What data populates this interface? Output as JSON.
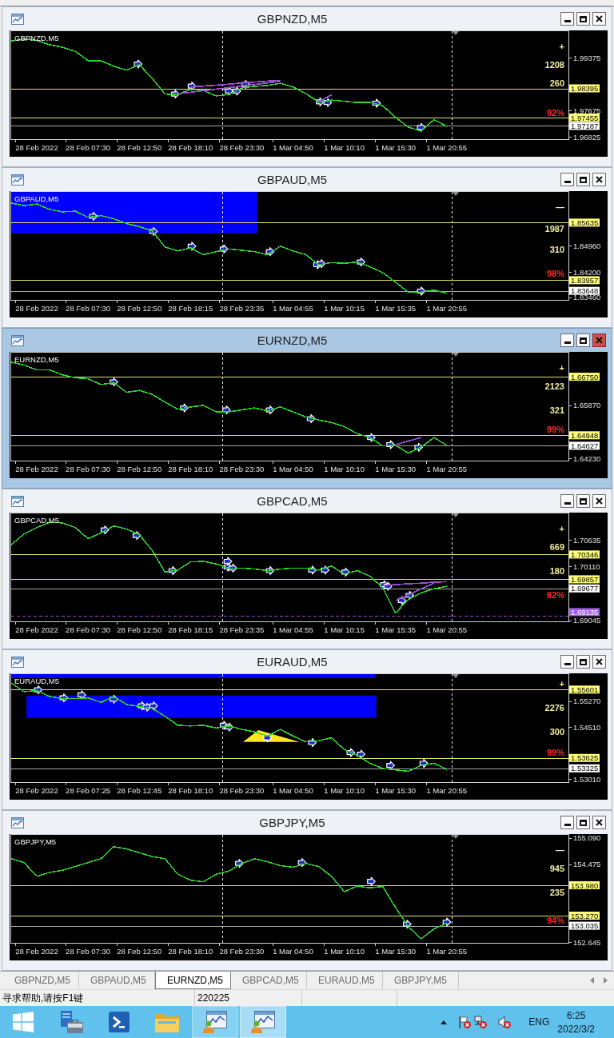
{
  "windows": [
    {
      "title": "GBPNZD,M5",
      "active": false,
      "chart_data": {
        "type": "line",
        "ylim": [
          1.9676,
          2.00238
        ],
        "categories": [
          null,
          null,
          "28 Feb 2022",
          null,
          null,
          null,
          "28 Feb 07:30",
          null,
          null,
          null,
          "28 Feb 12:50",
          null,
          null,
          null,
          "28 Feb 18:10",
          null,
          null,
          null,
          "28 Feb 23:30",
          null,
          null,
          null,
          "1 Mar 04:50",
          null,
          null,
          null,
          "1 Mar 10:10",
          null,
          null,
          null,
          "1 Mar 15:30",
          null,
          null,
          null,
          "1 Mar 20:55",
          null,
          null,
          null,
          null,
          null,
          null,
          null,
          null,
          null
        ],
        "yticks": [
          {
            "value": 1.99375,
            "label": "1.99375"
          },
          {
            "value": 1.97675,
            "label": "1.97675"
          },
          {
            "value": 1.96825,
            "label": "1.96825"
          }
        ],
        "series": [
          {
            "name": "GBPNZD,M5",
            "color": "#2fd52f",
            "values": [
              1.9992,
              1.9998,
              1.9994,
              1.998,
              1.9972,
              1.9959,
              1.9929,
              1.9929,
              1.9911,
              1.9898,
              1.9916,
              1.9872,
              1.9821,
              1.982,
              1.9836,
              1.9833,
              1.9815,
              1.982,
              1.9841,
              1.9846,
              1.9849,
              1.9856,
              1.9844,
              1.9823,
              1.9795,
              1.9802,
              1.9798,
              1.9794,
              1.9795,
              1.9784,
              1.9746,
              1.9715,
              1.9702,
              1.9739,
              1.9717,
              null,
              null,
              null,
              null,
              null,
              null,
              null,
              null,
              null
            ]
          },
          {
            "color": "#9b4fd0",
            "values": [
              null,
              null,
              null,
              null,
              null,
              null,
              null,
              null,
              null,
              null,
              null,
              null,
              null,
              1.9822,
              1.9827,
              1.9832,
              1.9837,
              1.9842,
              1.9847,
              1.9852,
              1.9857,
              1.9862,
              null,
              null,
              null,
              null,
              null,
              null,
              null,
              null,
              null,
              null,
              null,
              null,
              null,
              null,
              null,
              null,
              null,
              null,
              null,
              null,
              null,
              null
            ]
          },
          {
            "color": "#9b4fd0",
            "values": [
              null,
              null,
              null,
              null,
              null,
              null,
              null,
              null,
              null,
              null,
              null,
              null,
              null,
              null,
              1.9844,
              1.9847,
              1.985,
              1.9853,
              1.9857,
              1.986,
              1.9863,
              1.9866,
              null,
              null,
              null,
              null,
              null,
              null,
              null,
              null,
              null,
              null,
              null,
              null,
              null,
              null,
              null,
              null,
              null,
              null,
              null,
              null,
              null,
              null
            ]
          },
          {
            "color": "#9b4fd0",
            "values": [
              null,
              null,
              null,
              null,
              null,
              null,
              null,
              null,
              null,
              null,
              null,
              null,
              null,
              null,
              null,
              null,
              null,
              null,
              null,
              null,
              null,
              null,
              null,
              null,
              1.9796,
              1.9819,
              null,
              null,
              null,
              null,
              null,
              null,
              null,
              null,
              null,
              null,
              null,
              null,
              null,
              null,
              null,
              null,
              null,
              null
            ]
          }
        ],
        "ref_lines": [
          {
            "axis": "y",
            "value": 1.98395,
            "label": "1.98395",
            "color": "#e2e26a"
          },
          {
            "axis": "y",
            "value": 1.97455,
            "label": "1.97455",
            "color": "#e2e26a"
          },
          {
            "axis": "y",
            "value": 1.97187,
            "label": "1.97187",
            "color": "#a6a6a6"
          }
        ]
      },
      "indicator_labels": [
        {
          "text": "+",
          "color": "#f0eca0"
        },
        {
          "text": "1208",
          "color": "#f0eca0"
        },
        {
          "text": "260",
          "color": "#f0eca0"
        },
        {
          "text": "92%",
          "color": "#ff2828"
        }
      ]
    },
    {
      "title": "GBPAUD,M5",
      "active": false,
      "chart_data": {
        "type": "line",
        "ylim": [
          1.83384,
          1.86531
        ],
        "categories": [
          null,
          null,
          "28 Feb 2022",
          null,
          null,
          null,
          "28 Feb 07:30",
          null,
          null,
          null,
          "28 Feb 12:50",
          null,
          null,
          null,
          "28 Feb 18:15",
          null,
          null,
          null,
          "28 Feb 23:35",
          null,
          null,
          null,
          "1 Mar 04:55",
          null,
          null,
          null,
          "1 Mar 10:15",
          null,
          null,
          null,
          "1 Mar 15:35",
          null,
          null,
          null,
          "1 Mar 20:55",
          null,
          null,
          null,
          null,
          null,
          null,
          null,
          null,
          null
        ],
        "yticks": [
          {
            "value": 1.8496,
            "label": "1.84960"
          },
          {
            "value": 1.842,
            "label": "1.84200"
          },
          {
            "value": 1.8346,
            "label": "1.83460"
          }
        ],
        "series": [
          {
            "name": "GBPAUD,M5",
            "color": "#2fd52f",
            "values": [
              1.8621,
              1.8613,
              1.8618,
              1.8602,
              1.8595,
              1.8597,
              1.8579,
              1.8584,
              1.8575,
              1.8561,
              1.8552,
              1.8539,
              1.8493,
              1.8481,
              1.849,
              1.847,
              1.8479,
              1.8487,
              1.8483,
              1.8479,
              1.847,
              1.8495,
              1.8481,
              1.847,
              1.8441,
              1.8447,
              1.8445,
              1.8449,
              1.8435,
              1.8418,
              1.839,
              1.8361,
              1.8361,
              1.8367,
              1.8358,
              null,
              null,
              null,
              null,
              null,
              null,
              null,
              null,
              null
            ]
          }
        ],
        "ref_lines": [
          {
            "axis": "y",
            "value": 1.85635,
            "label": "1.85635",
            "color": "#e2e26a"
          },
          {
            "axis": "y",
            "value": 1.83957,
            "label": "1.83957",
            "color": "#e2e26a"
          },
          {
            "axis": "y",
            "value": 1.83648,
            "label": "1.83648",
            "color": "#a6a6a6"
          }
        ]
      },
      "indicator_labels": [
        {
          "text": "—",
          "color": "#f0f0f0"
        },
        {
          "text": "1987",
          "color": "#f0eca0"
        },
        {
          "text": "310",
          "color": "#f0eca0"
        },
        {
          "text": "98%",
          "color": "#ff2828"
        }
      ]
    },
    {
      "title": "EURNZD,M5",
      "active": true,
      "chart_data": {
        "type": "line",
        "ylim": [
          1.64168,
          1.67492
        ],
        "categories": [
          null,
          null,
          "28 Feb 2022",
          null,
          null,
          null,
          "28 Feb 07:30",
          null,
          null,
          null,
          "28 Feb 12:50",
          null,
          null,
          null,
          "28 Feb 18:10",
          null,
          null,
          null,
          "28 Feb 23:30",
          null,
          null,
          null,
          "1 Mar 04:50",
          null,
          null,
          null,
          "1 Mar 10:10",
          null,
          null,
          null,
          "1 Mar 15:30",
          null,
          null,
          null,
          "1 Mar 20:55",
          null,
          null,
          null,
          null,
          null,
          null,
          null,
          null,
          null
        ],
        "yticks": [
          {
            "value": 1.6587,
            "label": "1.65870"
          },
          {
            "value": 1.6423,
            "label": "1.64230"
          }
        ],
        "series": [
          {
            "name": "EURNZD,M5",
            "color": "#2fd52f",
            "values": [
              1.672,
              1.6711,
              1.6696,
              1.6696,
              1.6681,
              1.6672,
              1.6669,
              1.6651,
              1.6657,
              1.6627,
              1.6633,
              1.6621,
              1.6597,
              1.6575,
              1.6582,
              1.6587,
              1.6567,
              1.6567,
              1.6573,
              1.6579,
              1.657,
              1.6582,
              1.6567,
              1.6551,
              1.6542,
              1.6534,
              1.6522,
              1.65,
              1.6488,
              1.6462,
              1.6464,
              1.644,
              1.6458,
              1.6488,
              1.6464,
              null,
              null,
              null,
              null,
              null,
              null,
              null,
              null,
              null
            ]
          },
          {
            "color": "#9b4fd0",
            "values": [
              null,
              null,
              null,
              null,
              null,
              null,
              null,
              null,
              null,
              null,
              null,
              null,
              null,
              null,
              null,
              null,
              null,
              null,
              null,
              null,
              null,
              null,
              null,
              null,
              null,
              null,
              null,
              null,
              null,
              null,
              1.6466,
              1.6477,
              1.6488,
              null,
              null,
              null,
              null,
              null,
              null,
              null,
              null,
              null,
              null,
              null
            ]
          }
        ],
        "ref_lines": [
          {
            "axis": "y",
            "value": 1.6675,
            "label": "1.66750",
            "color": "#e2e26a"
          },
          {
            "axis": "y",
            "value": 1.64948,
            "label": "1.64948",
            "color": "#e2e26a"
          },
          {
            "axis": "y",
            "value": 1.64627,
            "label": "1.64627",
            "color": "#a6a6a6"
          }
        ]
      },
      "indicator_labels": [
        {
          "text": "+",
          "color": "#f0eca0"
        },
        {
          "text": "2123",
          "color": "#f0eca0"
        },
        {
          "text": "321",
          "color": "#f0eca0"
        },
        {
          "text": "99%",
          "color": "#ff2828"
        }
      ]
    },
    {
      "title": "GBPCAD,M5",
      "active": false,
      "chart_data": {
        "type": "line",
        "ylim": [
          1.69028,
          1.71157
        ],
        "categories": [
          null,
          null,
          "28 Feb 2022",
          null,
          null,
          null,
          "28 Feb 07:30",
          null,
          null,
          null,
          "28 Feb 12:50",
          null,
          null,
          null,
          "28 Feb 18:15",
          null,
          null,
          null,
          "28 Feb 23:35",
          null,
          null,
          null,
          "1 Mar 04:55",
          null,
          null,
          null,
          "1 Mar 10:15",
          null,
          null,
          null,
          "1 Mar 15:35",
          null,
          null,
          null,
          "1 Mar 20:55",
          null,
          null,
          null,
          null,
          null,
          null,
          null,
          null,
          null
        ],
        "yticks": [
          {
            "value": 1.70635,
            "label": "1.70635"
          },
          {
            "value": 1.7011,
            "label": "1.70110"
          },
          {
            "value": 1.69045,
            "label": "1.69045"
          }
        ],
        "series": [
          {
            "name": "GBPCAD,M5",
            "color": "#2fd52f",
            "values": [
              1.7054,
              1.7075,
              1.7088,
              1.7098,
              1.7097,
              1.7088,
              1.7066,
              1.7077,
              1.7091,
              1.7085,
              1.7074,
              1.7043,
              1.7,
              1.7004,
              1.702,
              1.7021,
              1.7016,
              1.7008,
              1.7008,
              1.7006,
              1.7003,
              1.7006,
              1.7008,
              1.7008,
              1.7004,
              1.7012,
              1.6996,
              1.7003,
              1.6992,
              1.6969,
              1.6919,
              1.6946,
              1.6959,
              1.6967,
              1.6972,
              null,
              null,
              null,
              null,
              null,
              null,
              null,
              null,
              null
            ]
          },
          {
            "color": "#9b4fd0",
            "values": [
              null,
              null,
              null,
              null,
              null,
              null,
              null,
              null,
              null,
              null,
              null,
              null,
              null,
              null,
              null,
              null,
              null,
              null,
              null,
              null,
              null,
              null,
              null,
              null,
              null,
              null,
              null,
              null,
              null,
              1.6974,
              1.6975,
              1.6977,
              1.6978,
              1.698,
              1.6981,
              null,
              null,
              null,
              null,
              null,
              null,
              null,
              null,
              null
            ]
          },
          {
            "color": "#9b4fd0",
            "values": [
              null,
              null,
              null,
              null,
              null,
              null,
              null,
              null,
              null,
              null,
              null,
              null,
              null,
              null,
              null,
              null,
              null,
              null,
              null,
              null,
              null,
              null,
              null,
              null,
              null,
              null,
              null,
              null,
              null,
              null,
              1.6944,
              1.6955,
              1.6967,
              1.6978,
              null,
              null,
              null,
              null,
              null,
              null,
              null,
              null,
              null,
              null
            ]
          }
        ],
        "ref_lines": [
          {
            "axis": "y",
            "value": 1.70346,
            "label": "1.70346",
            "color": "#e2e26a"
          },
          {
            "axis": "y",
            "value": 1.69857,
            "label": "1.69857",
            "color": "#e2e26a"
          },
          {
            "axis": "y",
            "value": 1.69677,
            "label": "1.69677",
            "color": "#a6a6a6"
          },
          {
            "axis": "y",
            "value": 1.69135,
            "label": "1.69135",
            "color": "#8a4fd8"
          }
        ]
      },
      "indicator_labels": [
        {
          "text": "+",
          "color": "#f0eca0"
        },
        {
          "text": "669",
          "color": "#f0eca0"
        },
        {
          "text": "180",
          "color": "#f0eca0"
        },
        {
          "text": "82%",
          "color": "#ff2828"
        }
      ]
    },
    {
      "title": "EURAUD,M5",
      "active": false,
      "chart_data": {
        "type": "line",
        "ylim": [
          1.52927,
          1.56046
        ],
        "categories": [
          null,
          null,
          "28 Feb 2022",
          null,
          null,
          null,
          "28 Feb 07:25",
          null,
          null,
          null,
          "28 Feb 12:45",
          null,
          null,
          null,
          "28 Feb 18:10",
          null,
          null,
          null,
          "28 Feb 23:30",
          null,
          null,
          null,
          "1 Mar 04:50",
          null,
          null,
          null,
          "1 Mar 10:10",
          null,
          null,
          null,
          "1 Mar 15:30",
          null,
          null,
          null,
          "1 Mar 20:55",
          null,
          null,
          null,
          null,
          null,
          null,
          null,
          null,
          null
        ],
        "yticks": [
          {
            "value": 1.5527,
            "label": "1.55270"
          },
          {
            "value": 1.5451,
            "label": "1.54510"
          },
          {
            "value": 1.5301,
            "label": "1.53010"
          }
        ],
        "series": [
          {
            "name": "EURAUD,M5",
            "color": "#2fd52f",
            "values": [
              1.5579,
              1.5554,
              1.5557,
              1.554,
              1.5534,
              1.5534,
              1.5536,
              1.5523,
              1.554,
              1.5517,
              1.5511,
              1.5506,
              1.5483,
              1.5457,
              1.5455,
              1.5457,
              1.5449,
              1.5455,
              1.5445,
              1.5438,
              1.5426,
              1.5445,
              1.5426,
              1.5409,
              1.5412,
              1.5421,
              1.5387,
              1.537,
              1.5347,
              1.5332,
              1.5328,
              1.5324,
              1.5341,
              1.5347,
              1.533,
              null,
              null,
              null,
              null,
              null,
              null,
              null,
              null,
              null
            ]
          }
        ],
        "ref_lines": [
          {
            "axis": "y",
            "value": 1.55601,
            "label": "1.55601",
            "color": "#e2e26a"
          },
          {
            "axis": "y",
            "value": 1.53625,
            "label": "1.53625",
            "color": "#e2e26a"
          },
          {
            "axis": "y",
            "value": 1.53325,
            "label": "1.53325",
            "color": "#a6a6a6"
          }
        ]
      },
      "indicator_labels": [
        {
          "text": "+",
          "color": "#f0eca0"
        },
        {
          "text": "2276",
          "color": "#f0eca0"
        },
        {
          "text": "300",
          "color": "#f0eca0"
        },
        {
          "text": "99%",
          "color": "#ff2828"
        }
      ]
    },
    {
      "title": "GBPJPY,M5",
      "active": false,
      "chart_data": {
        "type": "line",
        "ylim": [
          152.635,
          155.157
        ],
        "categories": [
          null,
          null,
          "28 Feb 2022",
          null,
          null,
          null,
          "28 Feb 07:30",
          null,
          null,
          null,
          "28 Feb 12:50",
          null,
          null,
          null,
          "28 Feb 18:10",
          null,
          null,
          null,
          "28 Feb 23:30",
          null,
          null,
          null,
          "1 Mar 04:50",
          null,
          null,
          null,
          "1 Mar 10:10",
          null,
          null,
          null,
          "1 Mar 15:30",
          null,
          null,
          null,
          "1 Mar 20:55",
          null,
          null,
          null,
          null,
          null,
          null,
          null,
          null,
          null
        ],
        "yticks": [
          {
            "value": 155.09,
            "label": "155.090"
          },
          {
            "value": 154.475,
            "label": "154.475"
          },
          {
            "value": 152.645,
            "label": "152.645"
          }
        ],
        "series": [
          {
            "name": "GBPJPY,M5",
            "color": "#2fd52f",
            "values": [
              154.6,
              154.51,
              154.19,
              154.28,
              154.33,
              154.42,
              154.51,
              154.6,
              154.88,
              154.83,
              154.74,
              154.65,
              154.6,
              154.24,
              154.1,
              154.06,
              154.24,
              154.31,
              154.49,
              154.6,
              154.53,
              154.44,
              154.4,
              154.49,
              154.42,
              154.19,
              153.83,
              153.96,
              153.92,
              153.95,
              153.46,
              153.01,
              152.73,
              152.96,
              153.09,
              null,
              null,
              null,
              null,
              null,
              null,
              null,
              null,
              null
            ]
          }
        ],
        "ref_lines": [
          {
            "axis": "y",
            "value": 153.98,
            "label": "153.980",
            "color": "#e2e26a"
          },
          {
            "axis": "y",
            "value": 153.27,
            "label": "153.270",
            "color": "#e2e26a"
          },
          {
            "axis": "y",
            "value": 153.035,
            "label": "153.035",
            "color": "#a6a6a6"
          }
        ]
      },
      "indicator_labels": [
        {
          "text": "—",
          "color": "#f0f0f0"
        },
        {
          "text": "945",
          "color": "#f0eca0"
        },
        {
          "text": "235",
          "color": "#f0eca0"
        },
        {
          "text": "94%",
          "color": "#ff2828"
        }
      ]
    }
  ],
  "tabs": [
    {
      "label": "GBPNZD,M5",
      "selected": false
    },
    {
      "label": "GBPAUD,M5",
      "selected": false
    },
    {
      "label": "EURNZD,M5",
      "selected": true
    },
    {
      "label": "GBPCAD,M5",
      "selected": false
    },
    {
      "label": "EURAUD,M5",
      "selected": false
    },
    {
      "label": "GBPJPY,M5",
      "selected": false
    }
  ],
  "status_bar": {
    "help_text": "寻求帮助,请按F1键",
    "field_2": "220225"
  },
  "taskbar": {
    "buttons": [
      {
        "kind": "start",
        "open": false,
        "selected": false
      },
      {
        "kind": "server_manager",
        "open": false,
        "selected": false
      },
      {
        "kind": "powershell",
        "open": false,
        "selected": false
      },
      {
        "kind": "explorer",
        "open": false,
        "selected": false
      },
      {
        "kind": "terminal",
        "open": true,
        "selected": false
      },
      {
        "kind": "terminal",
        "open": true,
        "selected": true
      }
    ],
    "tray": {
      "language": "ENG",
      "time": "6:25",
      "date": "2022/3/2"
    }
  }
}
